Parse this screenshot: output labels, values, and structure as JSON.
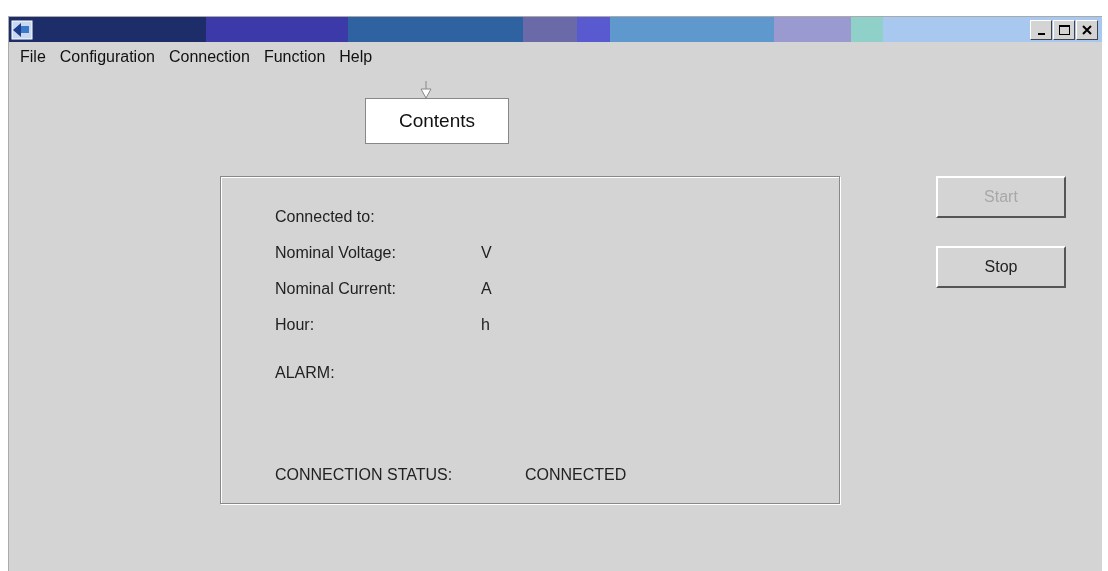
{
  "menu": [
    {
      "label": "File"
    },
    {
      "label": "Configuration"
    },
    {
      "label": "Connection"
    },
    {
      "label": "Function"
    },
    {
      "label": "Help"
    }
  ],
  "callout": {
    "label": "Contents"
  },
  "info": [
    {
      "label": "Connected to:"
    },
    {
      "label": "Nominal Voltage:",
      "value": "V"
    },
    {
      "label": "Nominal Current:",
      "value": "A"
    },
    {
      "label": "Hour:",
      "value": "h"
    }
  ],
  "alarm": {
    "label": "ALARM:"
  },
  "status": {
    "label": "CONNECTION STATUS:",
    "value": "CONNECTED"
  },
  "buttons": [
    {
      "label": "Start",
      "disabled": true
    },
    {
      "label": "Stop",
      "disabled": false
    }
  ]
}
